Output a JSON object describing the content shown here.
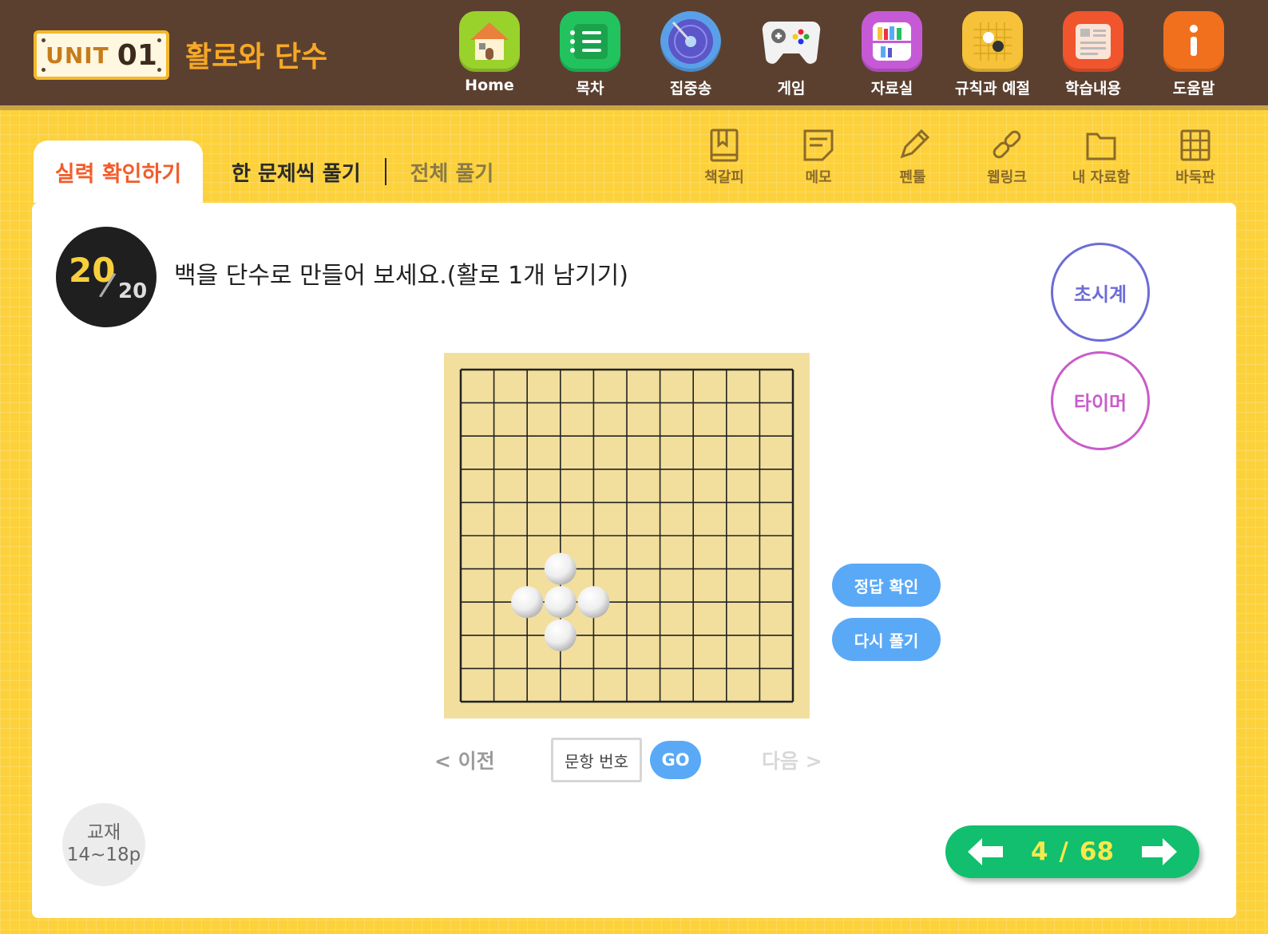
{
  "header": {
    "unit_label": "UNIT",
    "unit_number": "01",
    "unit_title": "활로와 단수",
    "nav": [
      {
        "label": "Home",
        "icon": "home-icon",
        "color": "#9ad22c"
      },
      {
        "label": "목차",
        "icon": "notebook-icon",
        "color": "#22c35e"
      },
      {
        "label": "집중송",
        "icon": "record-icon",
        "color": "#5aa0e8"
      },
      {
        "label": "게임",
        "icon": "gamepad-icon",
        "color": "#f0f0f0"
      },
      {
        "label": "자료실",
        "icon": "bookshelf-icon",
        "color": "#c65ad6"
      },
      {
        "label": "규칙과 예절",
        "icon": "go-board-icon",
        "color": "#f5c23a"
      },
      {
        "label": "학습내용",
        "icon": "document-icon",
        "color": "#f0552e"
      },
      {
        "label": "도움말",
        "icon": "info-icon",
        "color": "#f0701e"
      }
    ]
  },
  "tabs": {
    "active": "실력 확인하기",
    "one_by_one": "한 문제씩 풀기",
    "all": "전체 풀기"
  },
  "tools": [
    {
      "label": "책갈피",
      "icon": "bookmark-icon"
    },
    {
      "label": "메모",
      "icon": "memo-icon"
    },
    {
      "label": "펜툴",
      "icon": "pen-icon"
    },
    {
      "label": "웹링크",
      "icon": "link-icon"
    },
    {
      "label": "내 자료함",
      "icon": "folder-icon"
    },
    {
      "label": "바둑판",
      "icon": "grid-icon"
    }
  ],
  "problem": {
    "current": "20",
    "total": "20",
    "question": "백을 단수로 만들어 보세요.(활로 1개 남기기)"
  },
  "side_buttons": {
    "stopwatch": "초시계",
    "timer": "타이머"
  },
  "board": {
    "size": 11,
    "stones": [
      {
        "color": "white",
        "col": 3,
        "row": 6
      },
      {
        "color": "white",
        "col": 2,
        "row": 7
      },
      {
        "color": "white",
        "col": 3,
        "row": 7
      },
      {
        "color": "white",
        "col": 4,
        "row": 7
      },
      {
        "color": "white",
        "col": 3,
        "row": 8
      }
    ]
  },
  "actions": {
    "check_answer": "정답 확인",
    "retry": "다시 풀기"
  },
  "navigation": {
    "prev": "< 이전",
    "question_number_placeholder": "문항 번호",
    "go": "GO",
    "next": "다음 >"
  },
  "textbook": {
    "label": "교재",
    "pages": "14~18p"
  },
  "pager": {
    "current": "4",
    "separator": "/",
    "total": "68"
  }
}
